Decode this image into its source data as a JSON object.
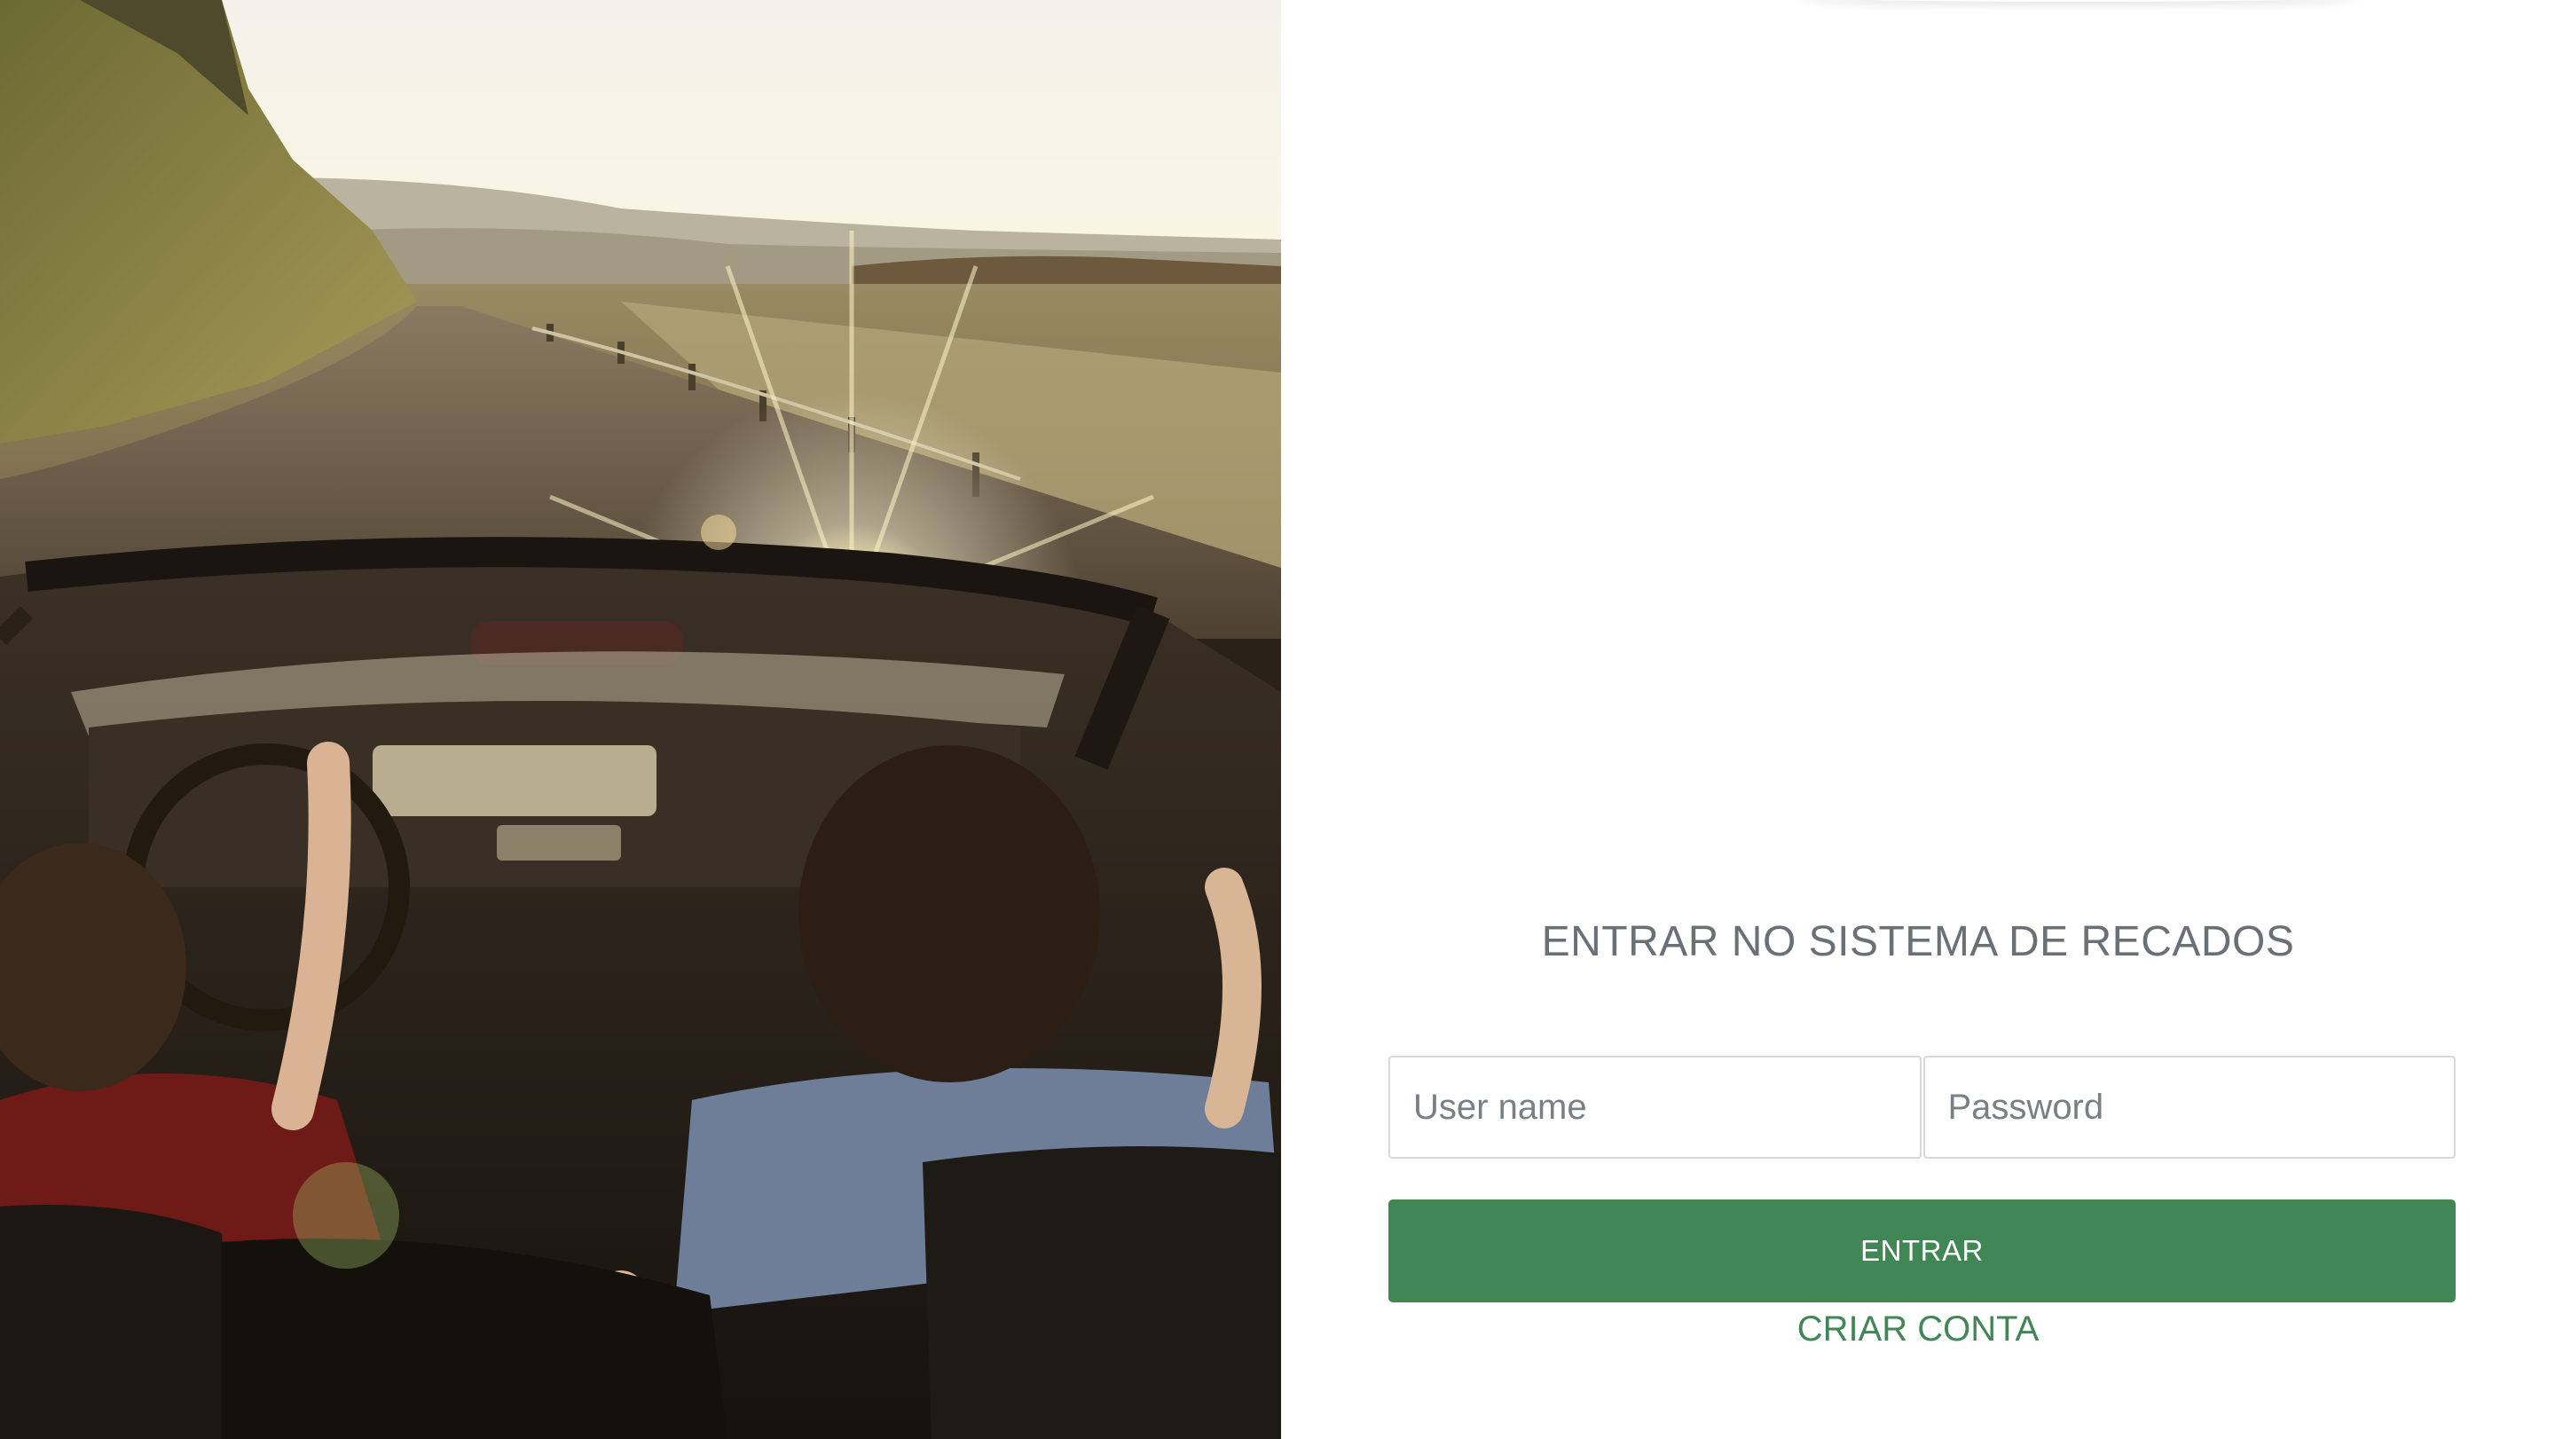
{
  "hero": {
    "image": "convertible-car-road-trip-photo"
  },
  "login": {
    "title": "ENTRAR NO SISTEMA DE RECADOS",
    "username_placeholder": "User name",
    "password_placeholder": "Password",
    "username_value": "",
    "password_value": "",
    "enter_label": "ENTRAR",
    "create_account_label": "CRIAR CONTA"
  },
  "colors": {
    "accent": "#418755",
    "title_text": "#6b6f76",
    "input_border": "#d9d9d9"
  }
}
